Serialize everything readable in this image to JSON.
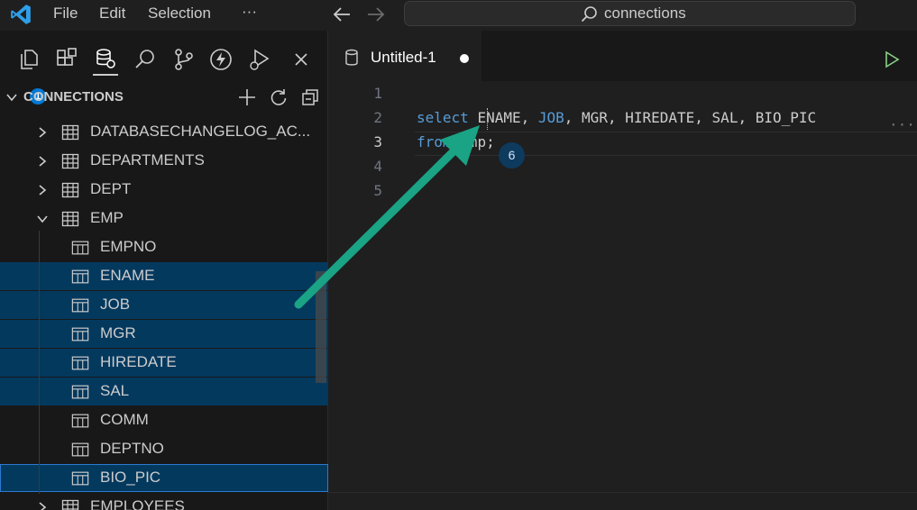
{
  "menu": {
    "file": "File",
    "edit": "Edit",
    "selection": "Selection",
    "more": "···"
  },
  "search": {
    "text": "connections"
  },
  "activity": {
    "badge_count": "1"
  },
  "section": {
    "title": "CONNECTIONS"
  },
  "tree": {
    "items": [
      {
        "label": "DATABASECHANGELOG_AC..."
      },
      {
        "label": "DEPARTMENTS"
      },
      {
        "label": "DEPT"
      },
      {
        "label": "EMP"
      },
      {
        "label": "EMPNO"
      },
      {
        "label": "ENAME"
      },
      {
        "label": "JOB"
      },
      {
        "label": "MGR"
      },
      {
        "label": "HIREDATE"
      },
      {
        "label": "SAL"
      },
      {
        "label": "COMM"
      },
      {
        "label": "DEPTNO"
      },
      {
        "label": "BIO_PIC"
      },
      {
        "label": "EMPLOYEES"
      }
    ]
  },
  "editor": {
    "tab_label": "Untitled-1",
    "line_numbers": [
      "1",
      "2",
      "3",
      "4",
      "5"
    ],
    "code": {
      "line2": {
        "kw": "select",
        "c1": "ENAME",
        "c2": "JOB",
        "c3": "MGR",
        "c4": "HIREDATE",
        "c5": "SAL",
        "c6": "BIO_PIC",
        "sep": ", "
      },
      "line3": {
        "kw": "from",
        "table": "emp",
        "end": ";"
      },
      "ellipsis": "···"
    },
    "selection_count": "6"
  },
  "colors": {
    "accent": "#0078d4",
    "selection": "#04395e",
    "keyword": "#569cd6",
    "arrow": "#1aa384",
    "run": "#89d185"
  }
}
